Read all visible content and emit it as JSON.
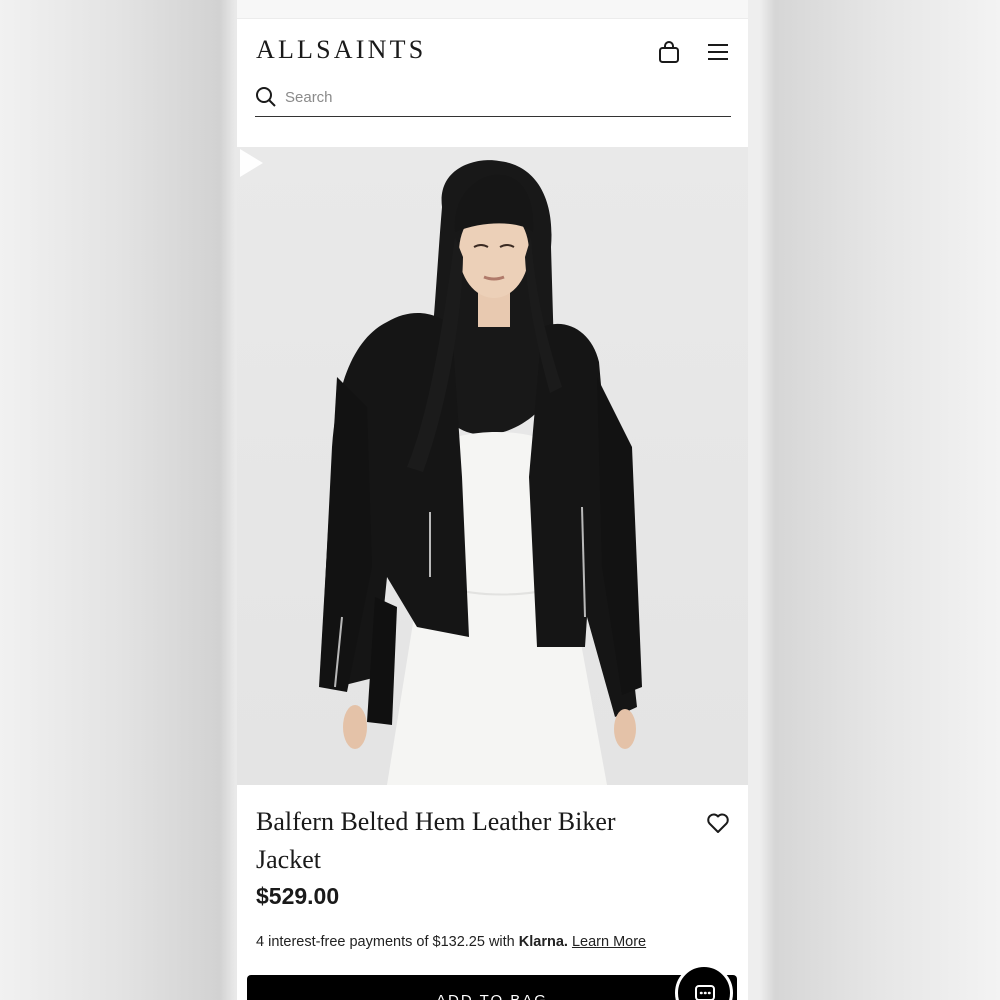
{
  "header": {
    "logo_text": "ALLSAINTS",
    "icons": {
      "bag": "shopping-bag-icon",
      "menu": "hamburger-menu-icon"
    }
  },
  "search": {
    "placeholder": "Search",
    "icon": "search-icon"
  },
  "product": {
    "image_alt": "Model wearing black leather biker jacket over white dress",
    "title": "Balfern Belted Hem Leather Biker Jacket",
    "price": "$529.00",
    "wishlist_icon": "heart-icon",
    "installments": {
      "prefix": "4 interest-free payments of $132.25 with",
      "provider": "Klarna.",
      "link": "Learn More"
    }
  },
  "actions": {
    "add_to_bag": "ADD TO BAG",
    "chat_icon": "chat-icon"
  },
  "colors": {
    "text": "#1a1a1a",
    "button": "#000000",
    "image_bg": "#e7e7e7"
  }
}
